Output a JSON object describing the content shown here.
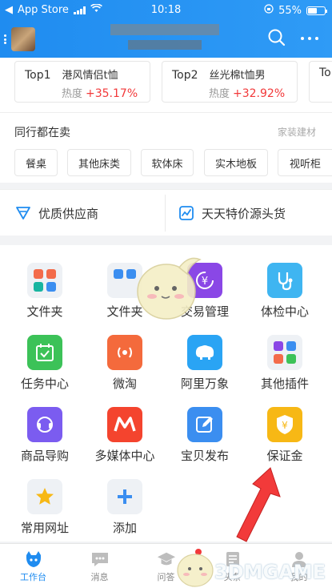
{
  "status": {
    "carrier": "App Store",
    "time": "10:18",
    "battery": "55%"
  },
  "top_list": [
    {
      "rank": "Top1",
      "name": "港风情侣t恤",
      "heat_label": "热度",
      "heat": "+35.17%"
    },
    {
      "rank": "Top2",
      "name": "丝光棉t恤男",
      "heat_label": "热度",
      "heat": "+32.92%"
    },
    {
      "rank": "To",
      "name": "",
      "heat_label": "",
      "heat": ""
    }
  ],
  "peers": {
    "title": "同行都在卖",
    "category": "家装建材",
    "chips": [
      "餐桌",
      "其他床类",
      "软体床",
      "实木地板",
      "视听柜"
    ]
  },
  "supply": {
    "left": "优质供应商",
    "right": "天天特价源头货"
  },
  "apps": [
    {
      "label": "文件夹",
      "icon": "folder-icon"
    },
    {
      "label": "文件夹",
      "icon": "folder-icon"
    },
    {
      "label": "交易管理",
      "icon": "yen-cycle-icon"
    },
    {
      "label": "体检中心",
      "icon": "stethoscope-icon"
    },
    {
      "label": "任务中心",
      "icon": "calendar-check-icon"
    },
    {
      "label": "微淘",
      "icon": "broadcast-icon"
    },
    {
      "label": "阿里万象",
      "icon": "elephant-icon"
    },
    {
      "label": "其他插件",
      "icon": "plugins-icon"
    },
    {
      "label": "商品导购",
      "icon": "headset-icon"
    },
    {
      "label": "多媒体中心",
      "icon": "media-m-icon"
    },
    {
      "label": "宝贝发布",
      "icon": "edit-icon"
    },
    {
      "label": "保证金",
      "icon": "shield-yen-icon"
    },
    {
      "label": "常用网址",
      "icon": "star-icon"
    },
    {
      "label": "添加",
      "icon": "plus-icon"
    }
  ],
  "tabs": [
    {
      "label": "工作台",
      "active": true,
      "icon": "workbench-icon"
    },
    {
      "label": "消息",
      "active": false,
      "icon": "message-icon"
    },
    {
      "label": "问答",
      "active": false,
      "icon": "graduation-cap-icon"
    },
    {
      "label": "头条",
      "active": false,
      "icon": "news-icon"
    },
    {
      "label": "我的",
      "active": false,
      "icon": "person-icon"
    }
  ],
  "watermark": "3DMGAME",
  "colors": {
    "primary": "#1f8cf0",
    "heat": "#f2393a"
  }
}
